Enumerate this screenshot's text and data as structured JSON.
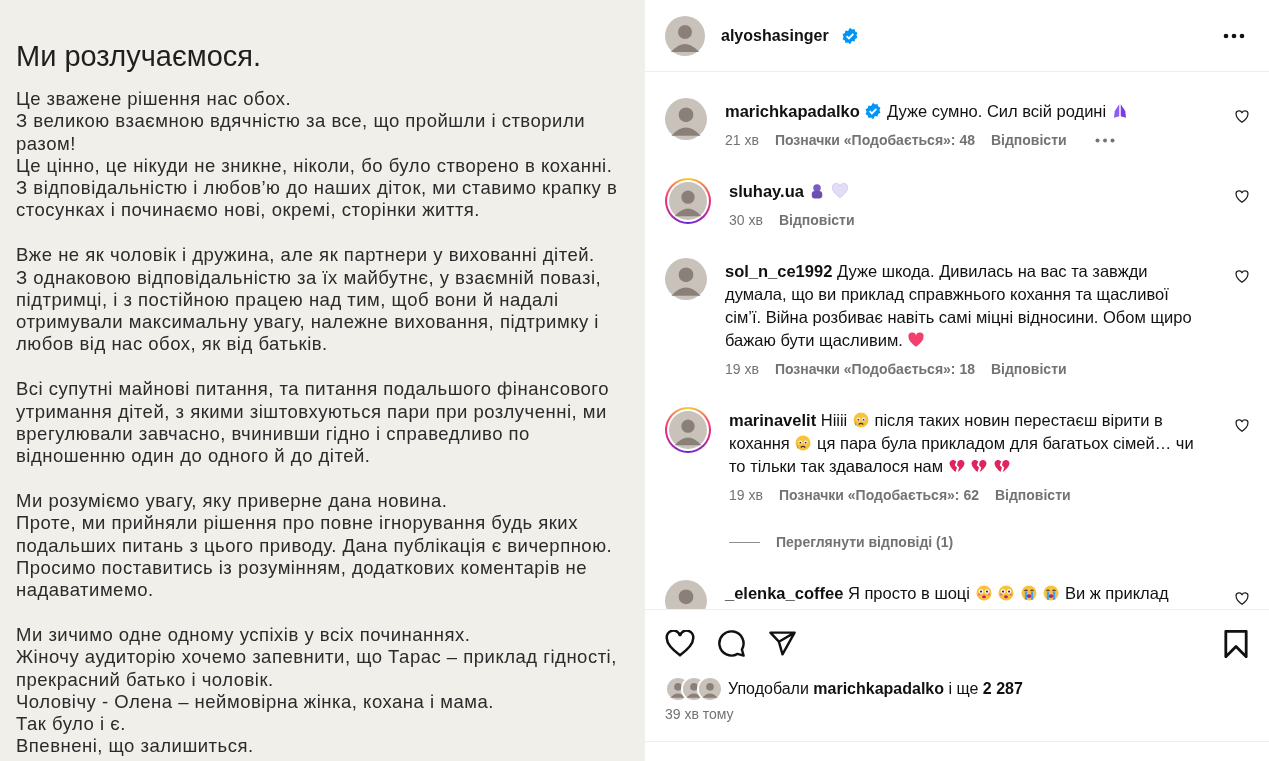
{
  "post_image": {
    "title": "Ми розлучаємося.",
    "paragraphs": [
      [
        "Це зважене рішення нас обох.",
        "З великою взаємною вдячністю за все, що пройшли і створили разом!",
        "Це цінно, це нікуди не зникне, ніколи, бо було створено в коханні.",
        "З відповідальністю і любов’ю до наших діток, ми ставимо крапку в стосунках і починаємо нові, окремі, сторінки життя."
      ],
      [
        "Вже не як чоловік і дружина, але як партнери у вихованні дітей.",
        "З однаковою відповідальністю за їх майбутнє, у взаємній повазі, підтримці, і з постійною працею над тим, щоб вони й надалі отримували максимальну увагу, належне виховання, підтримку і любов від нас обох, як від батьків."
      ],
      [
        "Всі супутні майнові питання, та питання подальшого фінансового утримання дітей, з якими зіштовхуються пари при розлученні, ми врегулювали завчасно, вчинивши гідно і справедливо по відношенню один до одного й до дітей."
      ],
      [
        "Ми розуміємо увагу, яку приверне дана новина.",
        "Проте, ми прийняли рішення про повне ігнорування будь яких подальших питань з цього приводу. Дана публікація є вичерпною.",
        "Просимо поставитись із розумінням, додаткових коментарів не надаватимемо."
      ],
      [
        "Ми зичимо одне одному успіхів у всіх починаннях.",
        "Жіночу аудиторію хочемо запевнити, що Тарас – приклад гідності, прекрасний батько і чоловік.",
        "Чоловічу - Олена – неймовірна жінка, кохана і мама.",
        "Так було і є.",
        "Впевнені, що залишиться."
      ]
    ]
  },
  "header": {
    "username": "alyoshasinger",
    "verified": true
  },
  "comments": [
    {
      "username": "marichkapadalko",
      "verified": true,
      "story": false,
      "segments": [
        {
          "kind": "text",
          "text": "Дуже сумно. Сил всій родині"
        },
        {
          "kind": "pray"
        }
      ],
      "time": "21 хв",
      "likes": "Позначки «Подобається»: 48",
      "reply": "Відповісти",
      "more": true
    },
    {
      "username": "sluhay.ua",
      "verified": false,
      "story": true,
      "segments": [
        {
          "kind": "hug"
        },
        {
          "kind": "white-heart"
        }
      ],
      "time": "30 хв",
      "reply": "Відповісти",
      "more": false
    },
    {
      "username": "sol_n_ce1992",
      "verified": false,
      "story": false,
      "segments": [
        {
          "kind": "text",
          "text": "Дуже шкода. Дивилась на вас та завжди думала, що ви приклад справжнього кохання та щасливої сім’ї. Війна розбиває навіть самі міцні відносини. Обом щиро бажаю бути щасливим."
        },
        {
          "kind": "heart"
        }
      ],
      "time": "19 хв",
      "likes": "Позначки «Подобається»: 18",
      "reply": "Відповісти",
      "more": false
    },
    {
      "username": "marinavelit",
      "verified": false,
      "story": true,
      "segments": [
        {
          "kind": "text",
          "text": "Hiiii"
        },
        {
          "kind": "crying"
        },
        {
          "kind": "text",
          "text": "після таких новин перестаєш вірити в кохання"
        },
        {
          "kind": "crying"
        },
        {
          "kind": "text",
          "text": "ця пара була прикладом для багатьох сімей… чи то тільки так здавалося нам"
        },
        {
          "kind": "broken-heart"
        },
        {
          "kind": "broken-heart"
        },
        {
          "kind": "broken-heart"
        }
      ],
      "time": "19 хв",
      "likes": "Позначки «Подобається»: 62",
      "reply": "Відповісти",
      "more": false,
      "view_replies": "Переглянути відповіді (1)"
    },
    {
      "username": "_elenka_coffee",
      "verified": false,
      "story": false,
      "segments": [
        {
          "kind": "text",
          "text": "Я просто в шоці"
        },
        {
          "kind": "flushed"
        },
        {
          "kind": "flushed"
        },
        {
          "kind": "sob"
        },
        {
          "kind": "sob"
        },
        {
          "kind": "text",
          "text": "Ви ж приклад"
        }
      ]
    }
  ],
  "likes_summary": "Уподобали **marichkapadalko** і ще **2 287**",
  "posted": "39 хв тому"
}
